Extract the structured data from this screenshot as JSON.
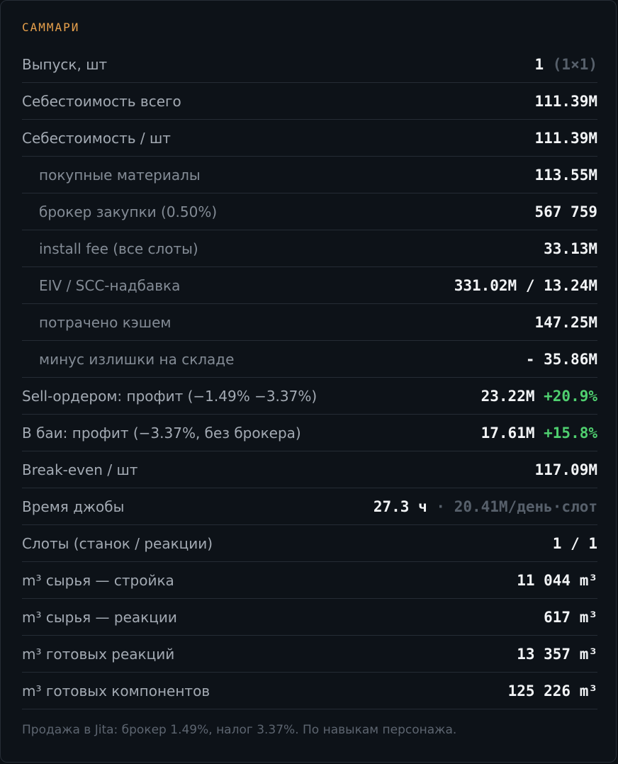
{
  "summary": {
    "title": "САММАРИ",
    "rows": [
      {
        "label": "Выпуск, шт",
        "value": "1",
        "extra": "(1×1)"
      },
      {
        "label": "Себестоимость всего",
        "value": "111.39M"
      },
      {
        "label": "Себестоимость / шт",
        "value": "111.39M"
      },
      {
        "label": "покупные материалы",
        "value": "113.55M"
      },
      {
        "label": "брокер закупки (0.50%)",
        "value": "567 759"
      },
      {
        "label": "install fee (все слоты)",
        "value": "33.13M"
      },
      {
        "label": "EIV / SCC-надбавка",
        "value": "331.02M / 13.24M"
      },
      {
        "label": "потрачено кэшем",
        "value": "147.25M"
      },
      {
        "label": "минус излишки на складе",
        "value": "- 35.86M"
      },
      {
        "label": "Sell-ордером: профит (−1.49% −3.37%)",
        "value": "23.22M",
        "pct": "+20.9%"
      },
      {
        "label": "В баи: профит (−3.37%, без брокера)",
        "value": "17.61M",
        "pct": "+15.8%"
      },
      {
        "label": "Break-even / шт",
        "value": "117.09M"
      },
      {
        "label": "Время джобы",
        "value": "27.3 ч",
        "sep": "·",
        "extra": "20.41M/день·слот"
      },
      {
        "label": "Слоты (станок / реакции)",
        "value": "1 / 1"
      },
      {
        "label": "m³ сырья — стройка",
        "value": "11 044 m³"
      },
      {
        "label": "m³ сырья — реакции",
        "value": "617 m³"
      },
      {
        "label": "m³ готовых реакций",
        "value": "13 357 m³"
      },
      {
        "label": "m³ готовых компонентов",
        "value": "125 226 m³"
      }
    ],
    "footnote": "Продажа в Jita: брокер 1.49%, налог 3.37%. По навыкам персонажа."
  },
  "colors": {
    "accent": "#e8a14c",
    "profit_green": "#4fcf6f",
    "background": "#0d1218"
  }
}
